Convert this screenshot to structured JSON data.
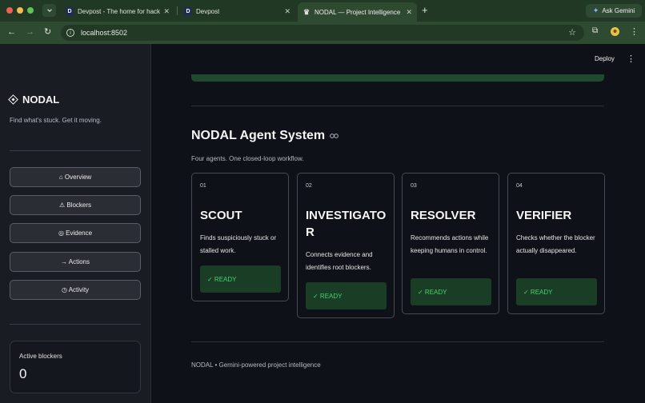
{
  "browser": {
    "tabs": [
      {
        "favicon": "D",
        "label": "Devpost - The home for hack",
        "active": false
      },
      {
        "favicon": "D",
        "label": "Devpost",
        "active": false
      },
      {
        "favicon": "nodal",
        "label": "NODAL — Project Intelligence",
        "active": true
      }
    ],
    "close_glyph": "✕",
    "new_tab_glyph": "+",
    "gemini_label": "Ask Gemini",
    "url": "localhost:8502"
  },
  "app": {
    "deploy_label": "Deploy",
    "brand": "NODAL",
    "tagline": "Find what's stuck. Get it moving.",
    "nav": [
      {
        "icon": "home-icon",
        "label": "⌂ Overview"
      },
      {
        "icon": "warning-icon",
        "label": "⚠ Blockers"
      },
      {
        "icon": "target-icon",
        "label": "◎ Evidence"
      },
      {
        "icon": "arrow-icon",
        "label": "→ Actions"
      },
      {
        "icon": "clock-icon",
        "label": "◷ Activity"
      }
    ],
    "metric": {
      "label": "Active blockers",
      "value": "0"
    },
    "section": {
      "title": "NODAL Agent System",
      "subtitle": "Four agents. One closed-loop workflow."
    },
    "agents": [
      {
        "num": "01",
        "name": "SCOUT",
        "desc": "Finds suspiciously stuck or stalled work.",
        "status": "✓ READY"
      },
      {
        "num": "02",
        "name": "INVESTIGATOR",
        "desc": "Connects evidence and identifies root blockers.",
        "status": "✓ READY"
      },
      {
        "num": "03",
        "name": "RESOLVER",
        "desc": "Recommends actions while keeping humans in control.",
        "status": "✓ READY"
      },
      {
        "num": "04",
        "name": "VERIFIER",
        "desc": "Checks whether the blocker actually disappeared.",
        "status": "✓ READY"
      }
    ],
    "footer": "NODAL • Gemini-powered project intelligence"
  }
}
